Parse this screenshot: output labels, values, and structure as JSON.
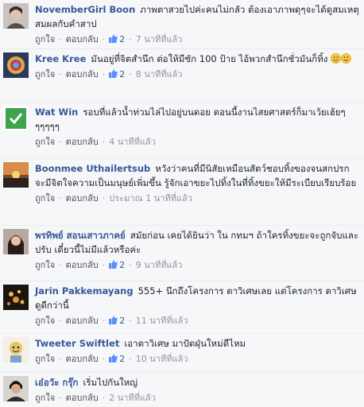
{
  "comments": [
    {
      "author": "NovemberGirl Boon",
      "text": "ภาพตาสวยไปค่ะคนไม่กลัว ต้องเอาภาพดุๆจะได้ดูสมเหตุสมผลกับคำสาป",
      "like": "ถูกใจ",
      "reply": "ตอบกลับ",
      "likes_count": "2",
      "time": "7 นาทีที่แล้ว",
      "avatar": "woman-portrait"
    },
    {
      "author": "Kree Kree",
      "text": "มันอยู่ที่จิตสำนึก ต่อให้มีซัก 100 ป้าย ไอ้พวกสำนึกชั่วมันก็ทิ้ง",
      "emoji": [
        "smile-emoji",
        "smile-emoji"
      ],
      "like": "ถูกใจ",
      "reply": "ตอบกลับ",
      "likes_count": "2",
      "time": "8 นาทีที่แล้ว",
      "avatar": "colorful-abstract"
    },
    {
      "author": "Wat Win",
      "text": "รอบที่แล้วน้ำท่วมไล่ไปอยู่บนดอย ตอนนี้งานไสยศาสตร์ก็มาเว้ยเฮ้ยๆๆๆๆๆๆ",
      "like": "ถูกใจ",
      "reply": "ตอบกลับ",
      "time": "4 นาทีที่แล้ว",
      "avatar": "green-check-logo"
    },
    {
      "author": "Boonmee Uthailertsub",
      "text": "หวังว่าคนที่มีนิสัยเหมือนสัตว์ชอบทิ้งของจนสกปรก จะมีจิตใจความเป็นมนุษย์เพิ่มขึ้น รู้จักเอาขยะไปทิ้งในที่ทิ้งขยะให้มีระเบียบเรียบร้อย",
      "like": "ถูกใจ",
      "reply": "ตอบกลับ",
      "time": "ประมาณ 1 นาทีที่แล้ว",
      "avatar": "sunset-landscape"
    },
    {
      "author": "พรทิพย์ สอนเสาวภาคย์",
      "text": "สมัยก่อน เคยได้ยินว่า ใน กทมฯ ถ้าใครทิ้งขยะจะถูกจับและปรับ เดี๋ยวนี้ไม่มีแล้วหรือค่ะ",
      "like": "ถูกใจ",
      "reply": "ตอบกลับ",
      "likes_count": "2",
      "time": "9 นาทีที่แล้ว",
      "avatar": "woman-dark-hair"
    },
    {
      "author": "Jarin Pakkemayang",
      "text": "555+ นึกถึงโครงการ ตาวิเศษเลย แต่โครงการ ตาวิเศษ ดูดีกว่านี้",
      "like": "ถูกใจ",
      "reply": "ตอบกลับ",
      "likes_count": "2",
      "time": "11 นาทีที่แล้ว",
      "avatar": "golden-lights"
    },
    {
      "author": "Tweeter Swiftlet",
      "text": "เอาตาวิเศษ มาปัดฝุ่นใหม่ดีไหม",
      "like": "ถูกใจ",
      "reply": "ตอบกลับ",
      "likes_count": "2",
      "time": "10 นาทีที่แล้ว",
      "avatar": "cartoon-character"
    },
    {
      "author": "เอ๋อวัะ กรุ๊ก",
      "text": "เริ่มไปกันใหญ่",
      "like": "ถูกใจ",
      "reply": "ตอบกลับ",
      "time": "2 นาทีที่แล้ว",
      "avatar": "man-portrait"
    }
  ]
}
